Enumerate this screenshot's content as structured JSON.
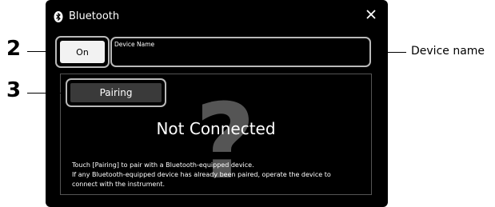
{
  "dialog": {
    "title": "Bluetooth",
    "on_button_label": "On",
    "device_name_label": "Device Name",
    "pairing_button_label": "Pairing",
    "status_text": "Not Connected",
    "info_lines": [
      "Touch [Pairing] to pair with a Bluetooth-equipped device.",
      "If any Bluetooth-equipped device has already been paired, operate the device to",
      "connect with the instrument."
    ],
    "icons": {
      "title": "bluetooth-icon",
      "close": "close-icon",
      "background": "question-mark-icon"
    }
  },
  "callouts": {
    "step_on": "2",
    "step_pairing": "3",
    "device_name_callout": "Device name"
  },
  "colors": {
    "panel_bg": "#000000",
    "highlight_border": "#b9b9b9",
    "on_button_bg": "#f2f2f2",
    "pairing_button_bg": "#3a3a3a",
    "question_mark": "#555555"
  }
}
